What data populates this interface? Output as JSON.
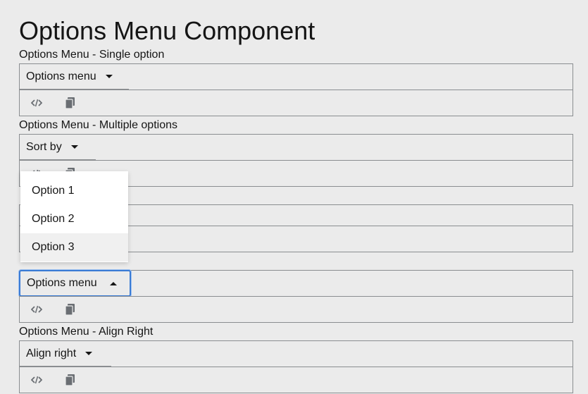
{
  "page": {
    "title": "Options Menu Component"
  },
  "sections": [
    {
      "label": "Options Menu - Single option",
      "toggle": "Options menu"
    },
    {
      "label": "Options Menu - Multiple options",
      "toggle": "Sort by"
    },
    {
      "toggle": "Options menu",
      "expanded": true,
      "menu": [
        "Option 1",
        "Option 2",
        "Option 3"
      ],
      "hovered_option": "Option 3"
    },
    {
      "label": "Options Menu - Align Right",
      "toggle": "Align right"
    }
  ],
  "toolbar": {
    "icons": [
      "code-icon",
      "copy-icon"
    ]
  },
  "colors": {
    "background": "#ebebeb",
    "border": "#8a8d90",
    "focus": "#3a7bd5",
    "menu_bg": "#ffffff",
    "menu_hover": "#f0f0f0"
  }
}
